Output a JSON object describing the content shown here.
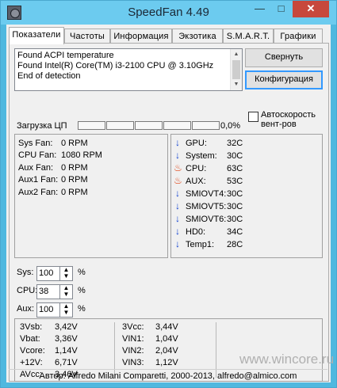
{
  "window": {
    "title": "SpeedFan 4.49",
    "minimize": "—",
    "maximize": "□",
    "close": "✕"
  },
  "tabs": [
    {
      "label": "Показатели"
    },
    {
      "label": "Частоты"
    },
    {
      "label": "Информация"
    },
    {
      "label": "Экзотика"
    },
    {
      "label": "S.M.A.R.T."
    },
    {
      "label": "Графики"
    }
  ],
  "log": {
    "lines": [
      "Found ACPI temperature",
      "Found Intel(R) Core(TM) i3-2100 CPU @ 3.10GHz",
      "End of detection"
    ]
  },
  "buttons": {
    "minimize": "Свернуть",
    "config": "Конфигурация"
  },
  "autospeed": {
    "label": "Автоскорость вент-ров",
    "checked": false
  },
  "cpu_usage": {
    "label": "Загрузка ЦП",
    "value": "0,0%",
    "percent": 0
  },
  "fans": [
    {
      "name": "Sys Fan:",
      "value": "0 RPM"
    },
    {
      "name": "CPU Fan:",
      "value": "1080 RPM"
    },
    {
      "name": "Aux Fan:",
      "value": "0 RPM"
    },
    {
      "name": "Aux1 Fan:",
      "value": "0 RPM"
    },
    {
      "name": "Aux2 Fan:",
      "value": "0 RPM"
    }
  ],
  "temps": [
    {
      "icon": "arrow-down-icon",
      "name": "GPU:",
      "value": "32C"
    },
    {
      "icon": "arrow-down-icon",
      "name": "System:",
      "value": "30C"
    },
    {
      "icon": "flame-icon",
      "name": "CPU:",
      "value": "63C"
    },
    {
      "icon": "flame-icon",
      "name": "AUX:",
      "value": "53C"
    },
    {
      "icon": "arrow-down-icon",
      "name": "SMIOVT4:",
      "value": "30C"
    },
    {
      "icon": "arrow-down-icon",
      "name": "SMIOVT5:",
      "value": "30C"
    },
    {
      "icon": "arrow-down-icon",
      "name": "SMIOVT6:",
      "value": "30C"
    },
    {
      "icon": "arrow-down-icon",
      "name": "HD0:",
      "value": "34C"
    },
    {
      "icon": "arrow-down-icon",
      "name": "Temp1:",
      "value": "28C"
    }
  ],
  "speeds": [
    {
      "label": "Sys:",
      "value": "100",
      "unit": "%"
    },
    {
      "label": "CPU:",
      "value": "38",
      "unit": "%"
    },
    {
      "label": "Aux:",
      "value": "100",
      "unit": "%"
    }
  ],
  "voltages": [
    {
      "name": "3Vsb:",
      "value": "3,42V"
    },
    {
      "name": "Vbat:",
      "value": "3,36V"
    },
    {
      "name": "Vcore:",
      "value": "1,14V"
    },
    {
      "name": "+12V:",
      "value": "6,71V"
    },
    {
      "name": "AVcc:",
      "value": "3,46V"
    },
    {
      "name": "3Vcc:",
      "value": "3,44V"
    },
    {
      "name": "VIN1:",
      "value": "1,04V"
    },
    {
      "name": "VIN2:",
      "value": "2,04V"
    },
    {
      "name": "VIN3:",
      "value": "1,12V"
    }
  ],
  "status": "Автор: Alfredo Milani Comparetti, 2000-2013, alfredo@almico.com",
  "watermark": "www.wincore.ru",
  "colors": {
    "accent": "#3399ff",
    "close": "#c7483c",
    "cold": "#1040d0",
    "hot": "#e04010"
  }
}
